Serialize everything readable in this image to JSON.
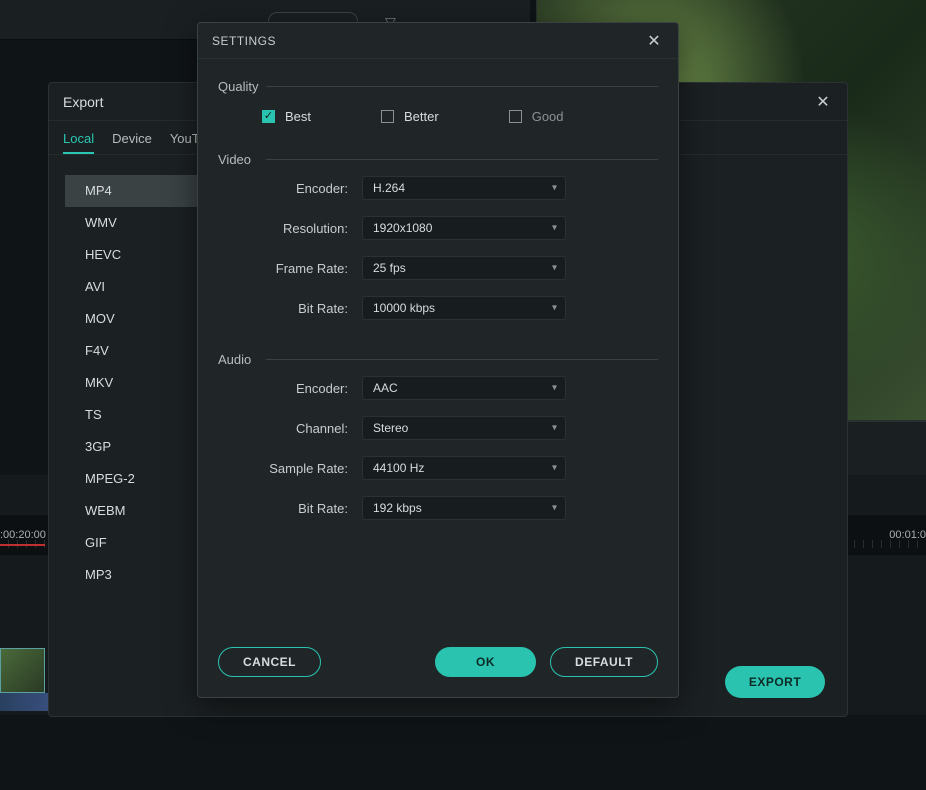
{
  "background": {
    "timeline": {
      "left_timestamp": ":00:20:00",
      "right_timestamp": "00:01:0"
    }
  },
  "export_modal": {
    "title": "Export",
    "tabs": [
      "Local",
      "Device",
      "YouTub"
    ],
    "active_tab": 0,
    "formats": [
      "MP4",
      "WMV",
      "HEVC",
      "AVI",
      "MOV",
      "F4V",
      "MKV",
      "TS",
      "3GP",
      "MPEG-2",
      "WEBM",
      "GIF",
      "MP3"
    ],
    "selected_format": 0,
    "export_label": "EXPORT"
  },
  "settings_modal": {
    "title": "SETTINGS",
    "quality": {
      "label": "Quality",
      "options": [
        "Best",
        "Better",
        "Good"
      ],
      "selected": 0
    },
    "video": {
      "label": "Video",
      "fields": {
        "encoder": {
          "label": "Encoder:",
          "value": "H.264"
        },
        "resolution": {
          "label": "Resolution:",
          "value": "1920x1080"
        },
        "framerate": {
          "label": "Frame Rate:",
          "value": "25 fps"
        },
        "bitrate": {
          "label": "Bit Rate:",
          "value": "10000 kbps"
        }
      }
    },
    "audio": {
      "label": "Audio",
      "fields": {
        "encoder": {
          "label": "Encoder:",
          "value": "AAC"
        },
        "channel": {
          "label": "Channel:",
          "value": "Stereo"
        },
        "samplerate": {
          "label": "Sample Rate:",
          "value": "44100 Hz"
        },
        "bitrate": {
          "label": "Bit Rate:",
          "value": "192 kbps"
        }
      }
    },
    "buttons": {
      "cancel": "CANCEL",
      "ok": "OK",
      "default": "DEFAULT"
    }
  }
}
